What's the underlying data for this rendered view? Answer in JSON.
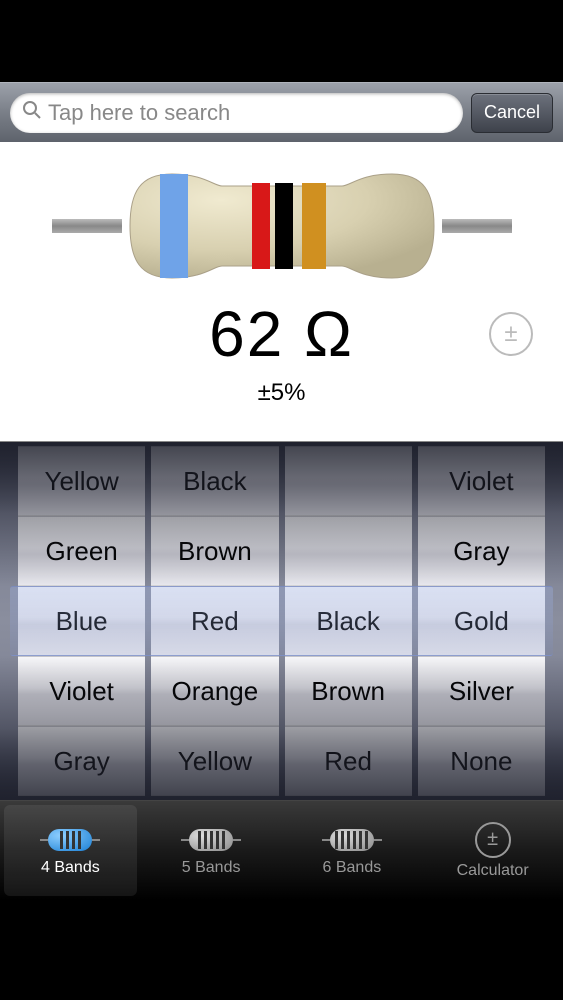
{
  "search": {
    "placeholder": "Tap here to search",
    "cancel_label": "Cancel"
  },
  "resistor": {
    "value": "62 Ω",
    "tolerance": "±5%",
    "band_colors": [
      "#6fa3e8",
      "#d81818",
      "#000000",
      "#d09020"
    ]
  },
  "picker": {
    "columns": [
      {
        "selected": "Blue",
        "visible": [
          "Yellow",
          "Green",
          "Blue",
          "Violet",
          "Gray"
        ]
      },
      {
        "selected": "Red",
        "visible": [
          "Black",
          "Brown",
          "Red",
          "Orange",
          "Yellow"
        ]
      },
      {
        "selected": "Black",
        "visible": [
          "",
          "",
          "Black",
          "Brown",
          "Red"
        ]
      },
      {
        "selected": "Gold",
        "visible": [
          "Violet",
          "Gray",
          "Gold",
          "Silver",
          "None"
        ]
      }
    ]
  },
  "tabs": {
    "items": [
      {
        "label": "4 Bands",
        "bands": 4,
        "active": true
      },
      {
        "label": "5 Bands",
        "bands": 5,
        "active": false
      },
      {
        "label": "6 Bands",
        "bands": 6,
        "active": false
      },
      {
        "label": "Calculator",
        "active": false
      }
    ]
  }
}
